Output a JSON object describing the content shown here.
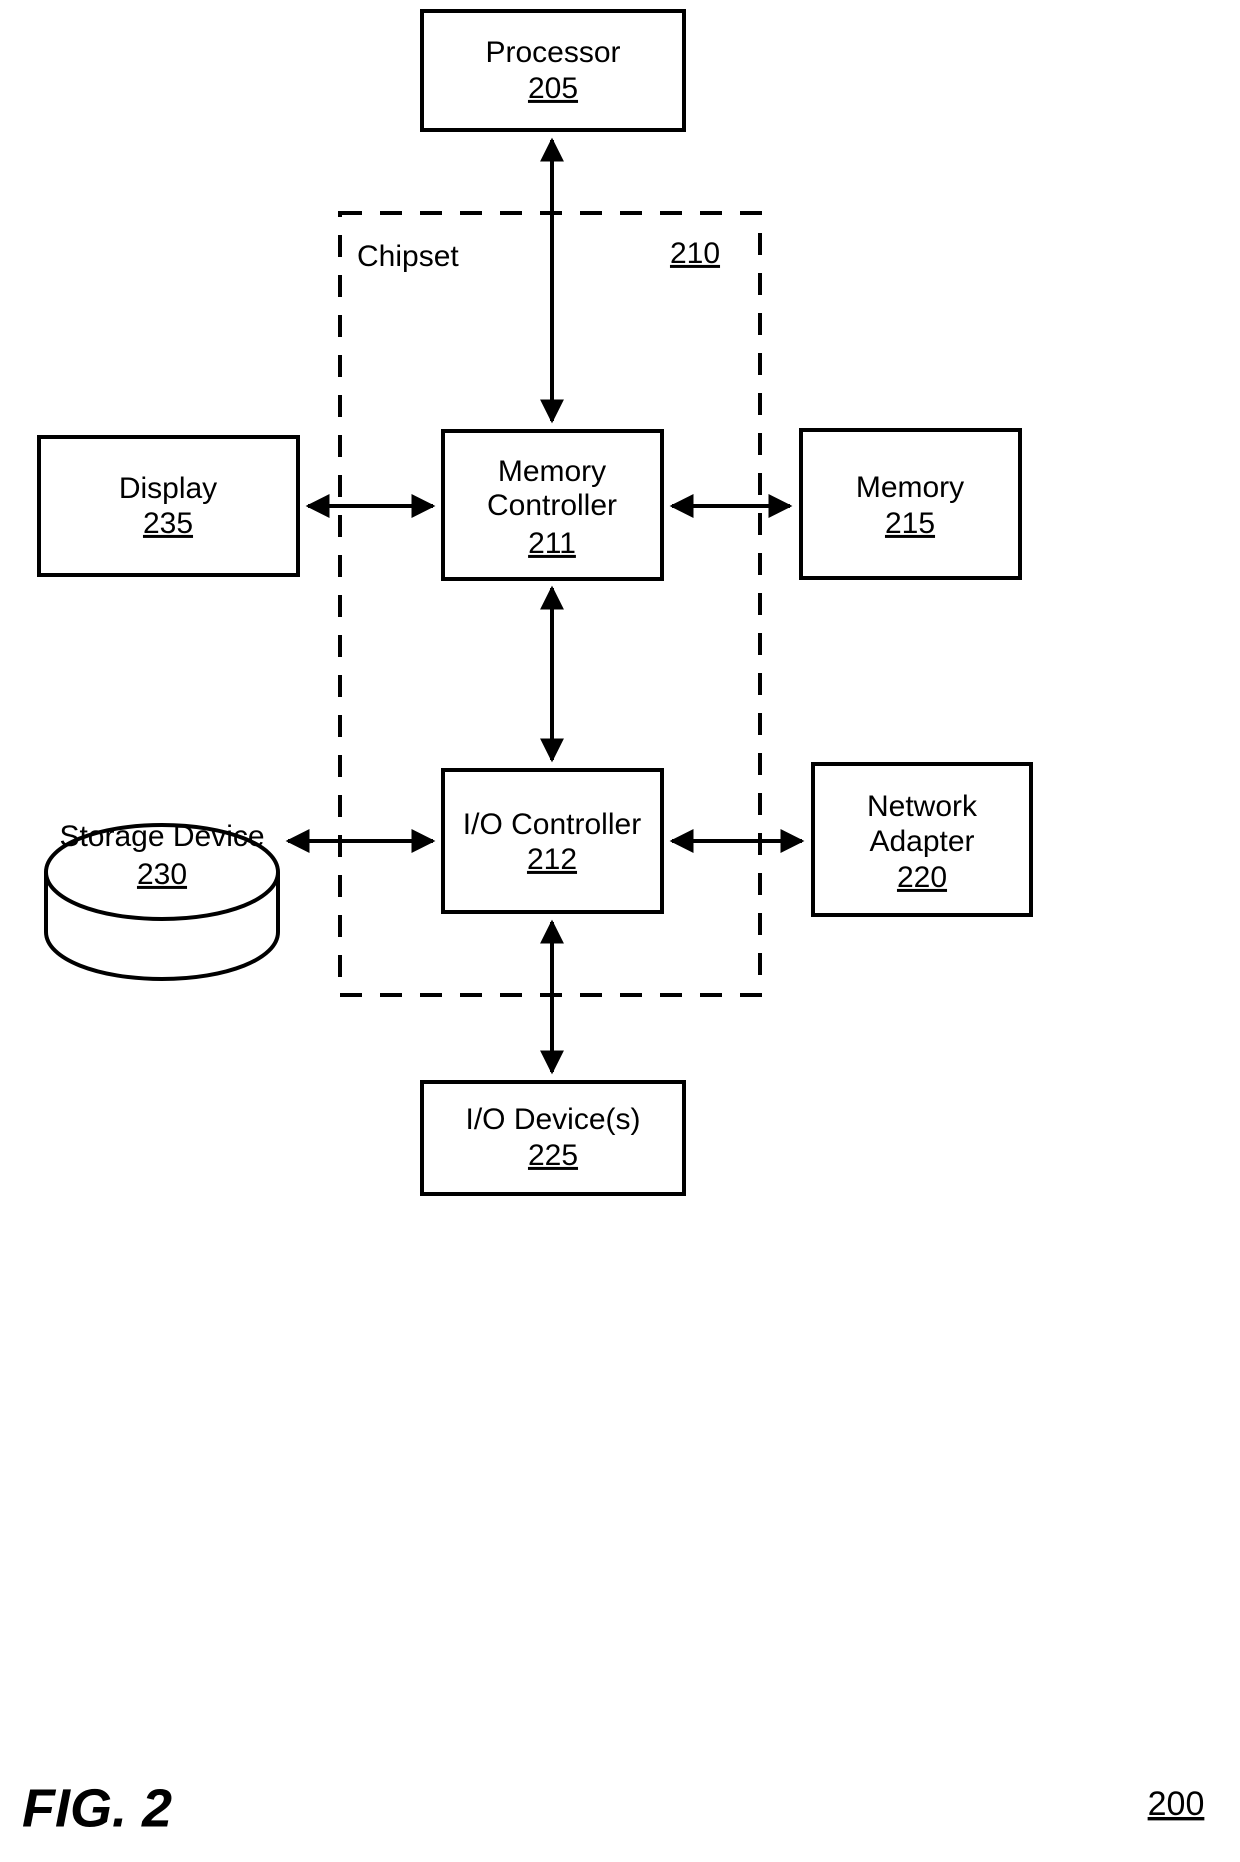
{
  "figure": {
    "caption": "FIG. 2",
    "reference": "200"
  },
  "region": {
    "label": "Chipset",
    "reference": "210"
  },
  "nodes": {
    "processor": {
      "label": "Processor",
      "reference": "205"
    },
    "memory_controller": {
      "label_line1": "Memory",
      "label_line2": "Controller",
      "reference": "211"
    },
    "io_controller": {
      "label": "I/O Controller",
      "reference": "212"
    },
    "display": {
      "label": "Display",
      "reference": "235"
    },
    "memory": {
      "label": "Memory",
      "reference": "215"
    },
    "storage_device": {
      "label": "Storage Device",
      "reference": "230"
    },
    "network_adapter": {
      "label_line1": "Network",
      "label_line2": "Adapter",
      "reference": "220"
    },
    "io_devices": {
      "label": "I/O Device(s)",
      "reference": "225"
    }
  },
  "colors": {
    "stroke": "#000000",
    "fill": "#ffffff"
  },
  "connections": [
    {
      "from": "processor",
      "to": "memory_controller",
      "style": "double-arrow"
    },
    {
      "from": "display",
      "to": "memory_controller",
      "style": "double-arrow"
    },
    {
      "from": "memory_controller",
      "to": "memory",
      "style": "double-arrow"
    },
    {
      "from": "memory_controller",
      "to": "io_controller",
      "style": "double-arrow"
    },
    {
      "from": "storage_device",
      "to": "io_controller",
      "style": "double-arrow"
    },
    {
      "from": "io_controller",
      "to": "network_adapter",
      "style": "double-arrow"
    },
    {
      "from": "io_controller",
      "to": "io_devices",
      "style": "double-arrow"
    }
  ]
}
